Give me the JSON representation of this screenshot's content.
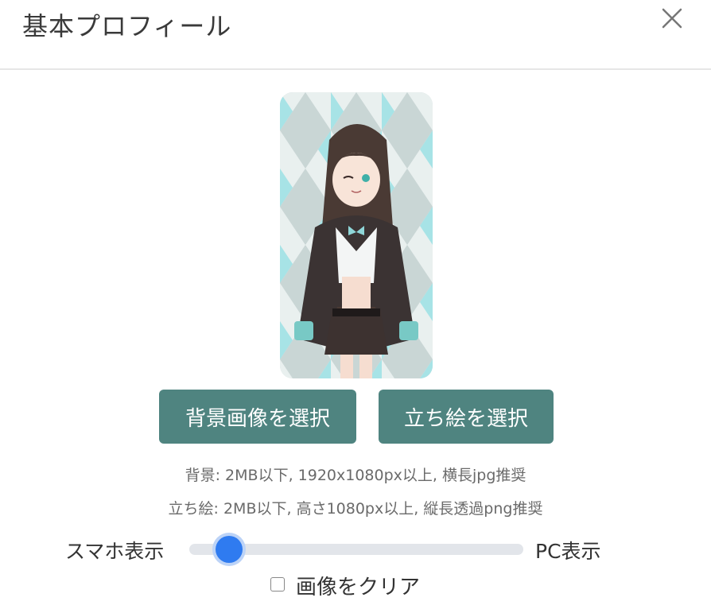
{
  "header": {
    "title": "基本プロフィール",
    "close_icon": "close-icon"
  },
  "preview": {
    "icon": "character-illustration",
    "bg_color": "#cfd9d9",
    "accent": "#a7e3e6"
  },
  "buttons": {
    "background": "背景画像を選択",
    "standing": "立ち絵を選択",
    "color": "#4f8480"
  },
  "notes": {
    "background": "背景: 2MB以下, 1920x1080px以上, 横長jpg推奨",
    "standing": "立ち絵: 2MB以下, 高さ1080px以上, 縦長透過png推奨"
  },
  "slider": {
    "left_label": "スマホ表示",
    "right_label": "PC表示",
    "value_fraction": 0.12,
    "accent": "#2f7bf0"
  },
  "clear": {
    "label": "画像をクリア",
    "checked": false
  }
}
